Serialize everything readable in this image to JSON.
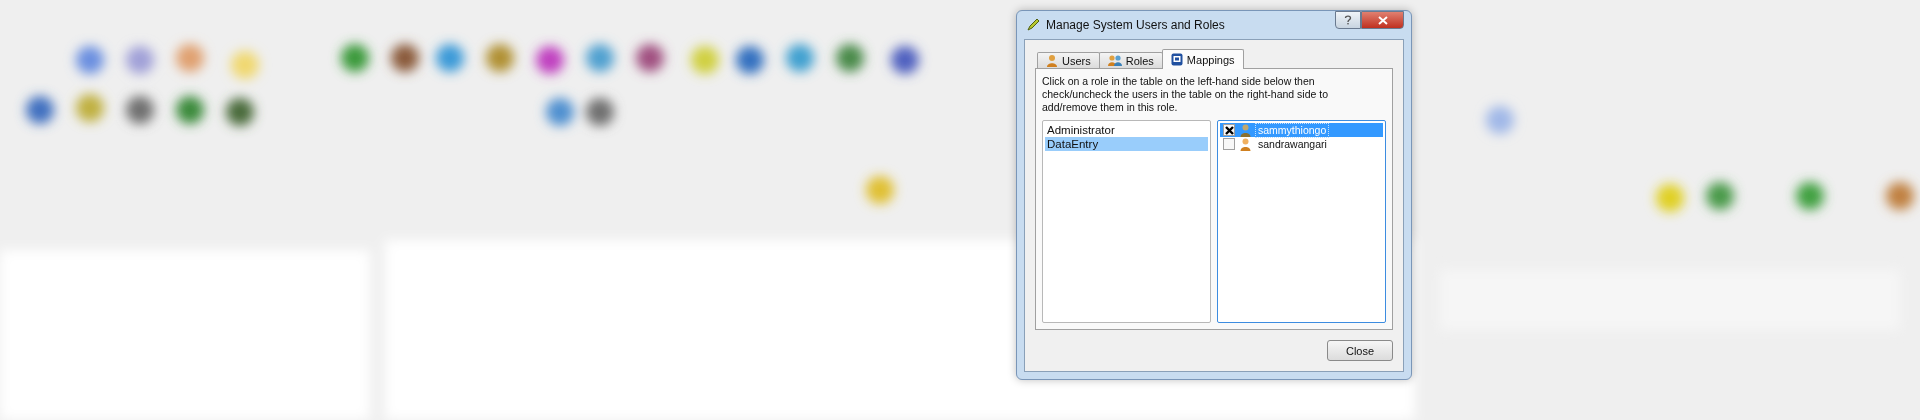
{
  "background": {
    "kind": "picture"
  },
  "window": {
    "title": "Manage System Users and Roles"
  },
  "tabs": [
    {
      "label": "Users",
      "selected": false,
      "kind": "user"
    },
    {
      "label": "Roles",
      "selected": false,
      "kind": "roles"
    },
    {
      "label": "Mappings",
      "selected": true,
      "kind": "mappings"
    }
  ],
  "instructions": "Click on a role in the table on the left-hand side below then check/uncheck the users in the table on the right-hand side to add/remove them in this role.",
  "roles": [
    {
      "name": "Administrator",
      "selected": false
    },
    {
      "name": "DataEntry",
      "selected": true
    }
  ],
  "users": [
    {
      "name": "sammythiongo",
      "checked": true,
      "selected": true
    },
    {
      "name": "sandrawangari",
      "checked": false,
      "selected": false
    }
  ],
  "buttons": [
    "Close"
  ]
}
